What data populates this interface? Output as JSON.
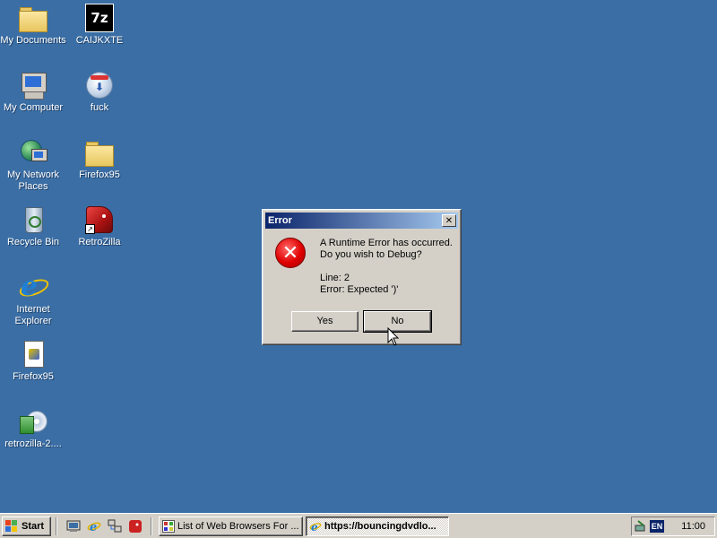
{
  "desktop": {
    "icons": [
      {
        "label": "My Documents"
      },
      {
        "label": "CAIJKXTE"
      },
      {
        "label": "My Computer"
      },
      {
        "label": "fuck"
      },
      {
        "label": "My Network Places"
      },
      {
        "label": "Firefox95"
      },
      {
        "label": "Recycle Bin"
      },
      {
        "label": "RetroZilla"
      },
      {
        "label": "Internet Explorer"
      },
      {
        "label": "Firefox95"
      },
      {
        "label": "retrozilla-2...."
      }
    ],
    "icon_7z_text": "7z"
  },
  "dialog": {
    "title": "Error",
    "close_glyph": "✕",
    "icon_glyph": "✕",
    "message": "A Runtime Error has occurred.\nDo you wish to Debug?\n\nLine: 2\nError: Expected ')'",
    "yes_label": "Yes",
    "no_label": "No"
  },
  "taskbar": {
    "start_label": "Start",
    "tasks": [
      {
        "label": "List of Web Browsers For ..."
      },
      {
        "label": "https://bouncingdvdlo..."
      }
    ],
    "language": "EN",
    "clock": "11:00"
  },
  "colors": {
    "desktop": "#3a6ea5",
    "titlebar_start": "#0a246a",
    "titlebar_end": "#a6caf0",
    "error_red": "#e00000"
  }
}
